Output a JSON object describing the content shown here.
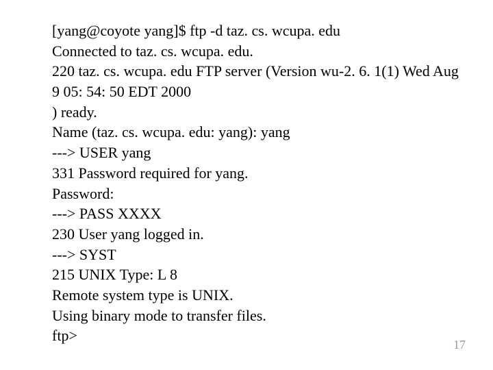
{
  "terminal": {
    "lines": [
      "[yang@coyote yang]$ ftp -d taz. cs. wcupa. edu",
      "Connected to taz. cs. wcupa. edu.",
      "220 taz. cs. wcupa. edu FTP server (Version wu-2. 6. 1(1) Wed Aug 9 05: 54: 50 EDT 2000",
      ") ready.",
      "Name (taz. cs. wcupa. edu: yang): yang",
      "---> USER yang",
      "331 Password required for yang.",
      "Password:",
      "---> PASS XXXX",
      "230 User yang logged in.",
      "---> SYST",
      "215 UNIX Type: L 8",
      "Remote system type is UNIX.",
      "Using binary mode to transfer files.",
      "ftp>"
    ]
  },
  "page_number": "17"
}
